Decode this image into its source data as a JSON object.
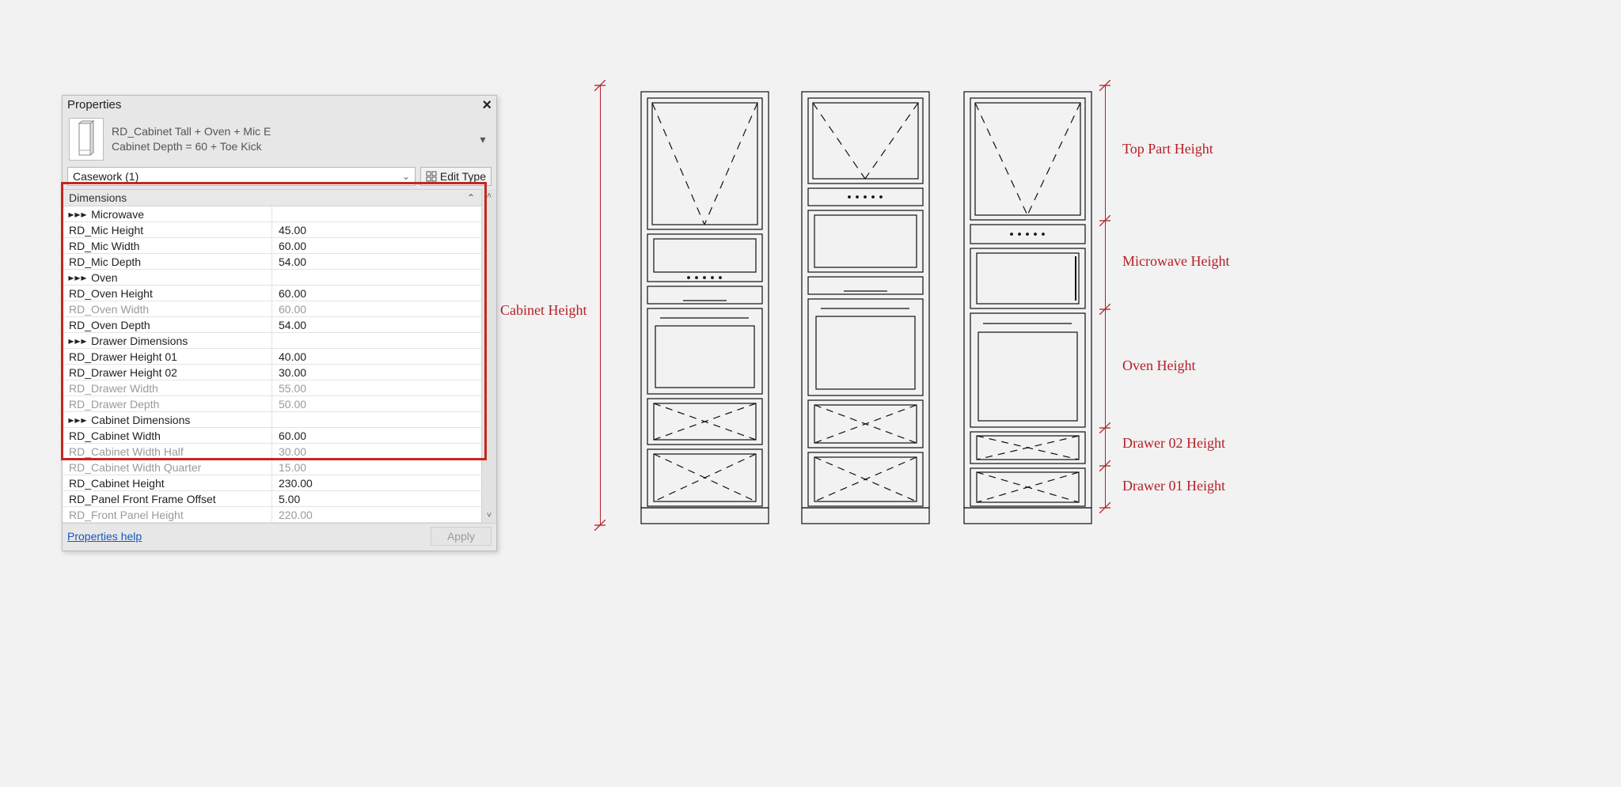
{
  "panel": {
    "title": "Properties",
    "type_name": "RD_Cabinet Tall + Oven + Mic E",
    "type_sub": "Cabinet Depth = 60 + Toe Kick",
    "selector_label": "Casework (1)",
    "edit_type": "Edit Type",
    "category": "Dimensions",
    "rows": [
      {
        "sep": true,
        "label": "Microwave"
      },
      {
        "label": "RD_Mic Height",
        "value": "45.00"
      },
      {
        "label": "RD_Mic Width",
        "value": "60.00"
      },
      {
        "label": "RD_Mic Depth",
        "value": "54.00"
      },
      {
        "sep": true,
        "label": "Oven"
      },
      {
        "label": "RD_Oven Height",
        "value": "60.00"
      },
      {
        "label": "RD_Oven Width",
        "value": "60.00",
        "dim": true
      },
      {
        "label": "RD_Oven Depth",
        "value": "54.00"
      },
      {
        "sep": true,
        "label": "Drawer Dimensions"
      },
      {
        "label": "RD_Drawer Height 01",
        "value": "40.00"
      },
      {
        "label": "RD_Drawer Height 02",
        "value": "30.00"
      },
      {
        "label": "RD_Drawer Width",
        "value": "55.00",
        "dim": true
      },
      {
        "label": "RD_Drawer Depth",
        "value": "50.00",
        "dim": true
      },
      {
        "sep": true,
        "label": "Cabinet Dimensions"
      },
      {
        "label": "RD_Cabinet Width",
        "value": "60.00"
      },
      {
        "label": "RD_Cabinet Width Half",
        "value": "30.00",
        "dim": true
      },
      {
        "label": "RD_Cabinet Width Quarter",
        "value": "15.00",
        "dim": true
      },
      {
        "label": "RD_Cabinet Height",
        "value": "230.00"
      },
      {
        "label": "RD_Panel Front Frame Offset",
        "value": "5.00"
      },
      {
        "label": "RD_Front Panel Height",
        "value": "220.00",
        "dim": true
      }
    ],
    "help": "Properties help",
    "apply": "Apply"
  },
  "annotations": {
    "cabinet_height": "Cabinet Height",
    "top": "Top Part Height",
    "micro": "Microwave Height",
    "oven": "Oven Height",
    "d2": "Drawer 02 Height",
    "d1": "Drawer 01 Height"
  }
}
